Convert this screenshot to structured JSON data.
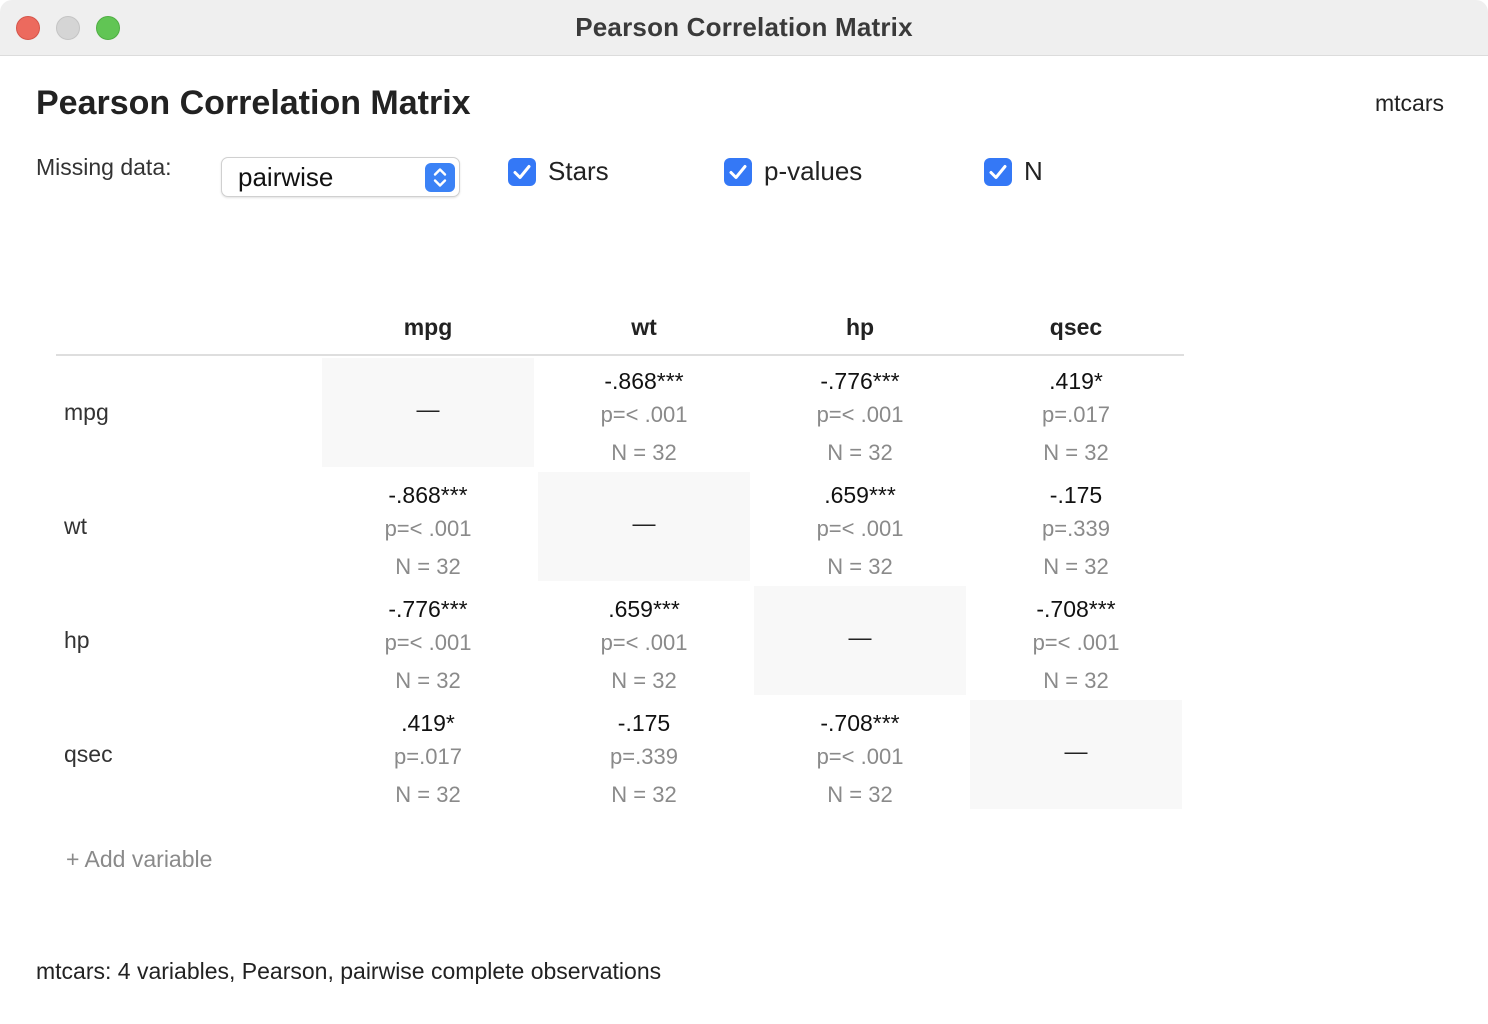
{
  "window": {
    "title": "Pearson Correlation Matrix"
  },
  "header": {
    "title": "Pearson Correlation Matrix",
    "dataset": "mtcars"
  },
  "controls": {
    "missing_label": "Missing data:",
    "missing_value": "pairwise",
    "stars": {
      "label": "Stars",
      "checked": true
    },
    "pvalues": {
      "label": "p-values",
      "checked": true
    },
    "n": {
      "label": "N",
      "checked": true
    }
  },
  "matrix": {
    "columns": [
      "mpg",
      "wt",
      "hp",
      "qsec"
    ],
    "rows": [
      {
        "label": "mpg",
        "cells": [
          {
            "diagonal": true,
            "r": "—"
          },
          {
            "r": "-.868***",
            "p": "p=< .001",
            "n": "N = 32"
          },
          {
            "r": "-.776***",
            "p": "p=< .001",
            "n": "N = 32"
          },
          {
            "r": ".419*",
            "p": "p=.017",
            "n": "N = 32"
          }
        ]
      },
      {
        "label": "wt",
        "cells": [
          {
            "r": "-.868***",
            "p": "p=< .001",
            "n": "N = 32"
          },
          {
            "diagonal": true,
            "r": "—"
          },
          {
            "r": ".659***",
            "p": "p=< .001",
            "n": "N = 32"
          },
          {
            "r": "-.175",
            "p": "p=.339",
            "n": "N = 32"
          }
        ]
      },
      {
        "label": "hp",
        "cells": [
          {
            "r": "-.776***",
            "p": "p=< .001",
            "n": "N = 32"
          },
          {
            "r": ".659***",
            "p": "p=< .001",
            "n": "N = 32"
          },
          {
            "diagonal": true,
            "r": "—"
          },
          {
            "r": "-.708***",
            "p": "p=< .001",
            "n": "N = 32"
          }
        ]
      },
      {
        "label": "qsec",
        "cells": [
          {
            "r": ".419*",
            "p": "p=.017",
            "n": "N = 32"
          },
          {
            "r": "-.175",
            "p": "p=.339",
            "n": "N = 32"
          },
          {
            "r": "-.708***",
            "p": "p=< .001",
            "n": "N = 32"
          },
          {
            "diagonal": true,
            "r": "—"
          }
        ]
      }
    ]
  },
  "actions": {
    "add_variable": "+ Add variable"
  },
  "status": {
    "text": "mtcars: 4 variables, Pearson, pairwise complete observations"
  },
  "colors": {
    "accent": "#3478f6",
    "close": "#ec6a5e",
    "zoom": "#61c554",
    "diagonal_fill": "#f8f8f8"
  }
}
